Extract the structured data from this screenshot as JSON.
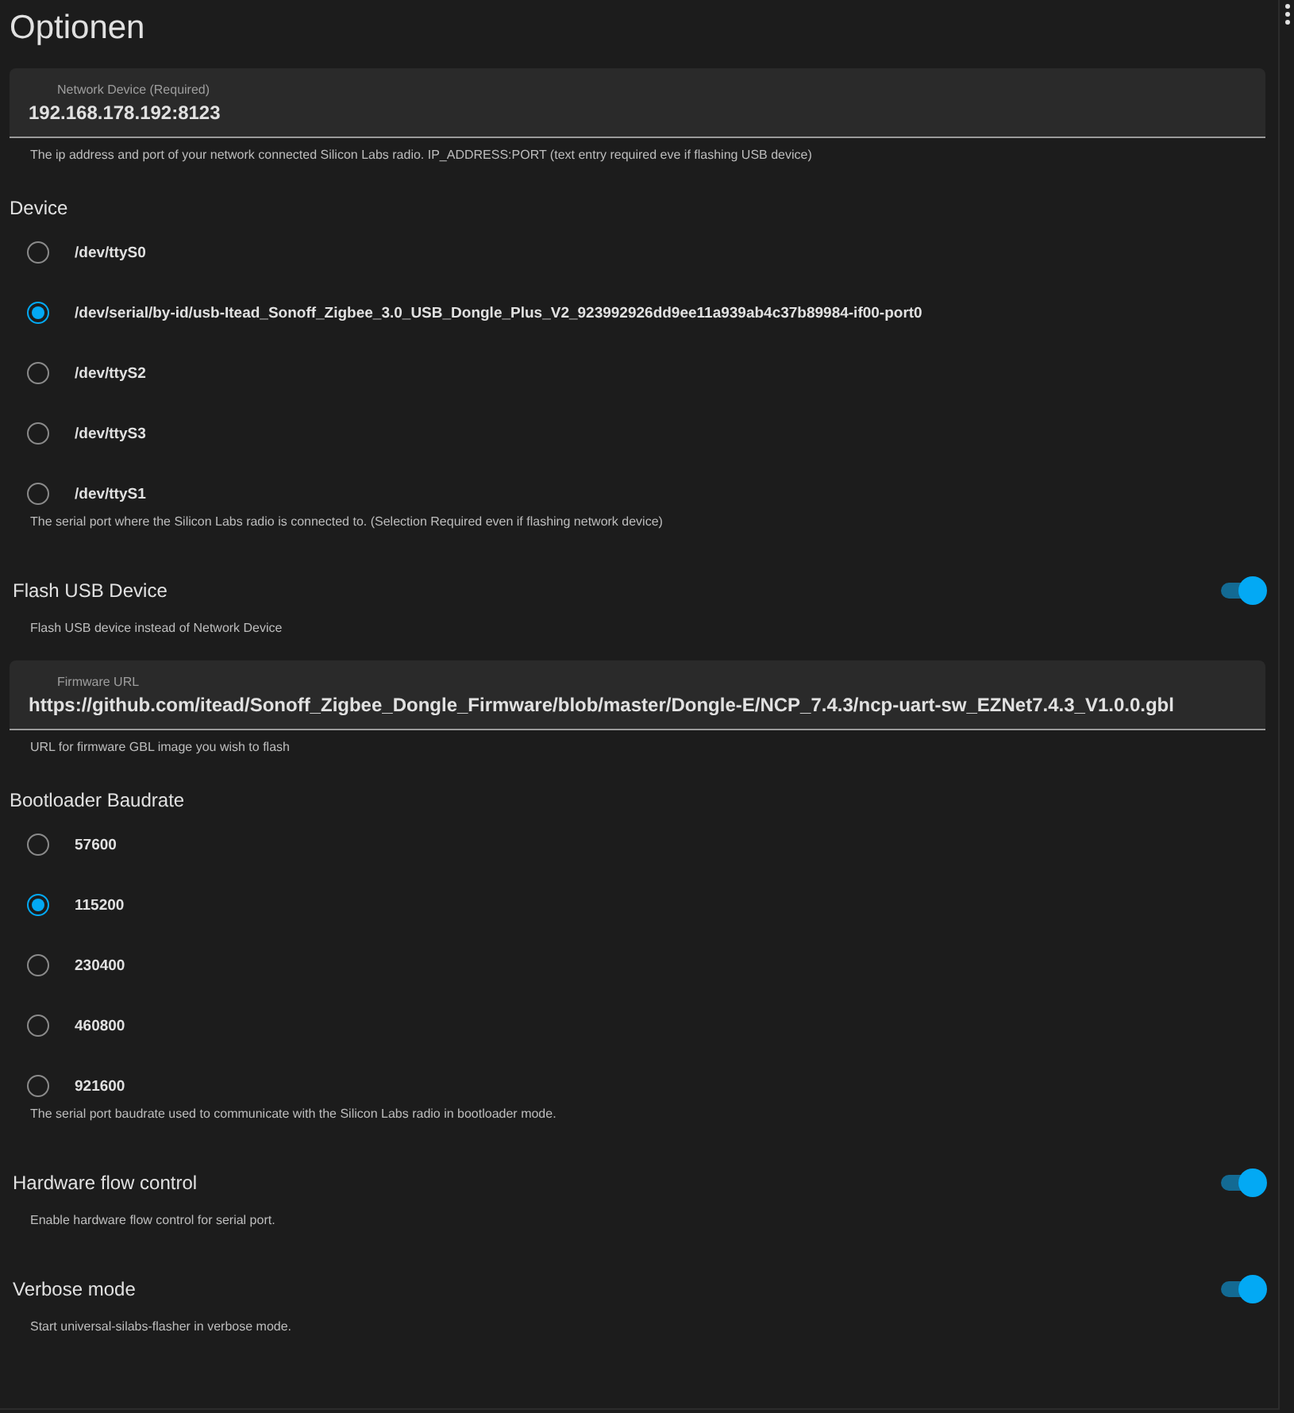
{
  "title": "Optionen",
  "sections": [
    {
      "kind": "text_field",
      "label": "Network Device (Required)",
      "value": "192.168.178.192:8123",
      "helper": "The ip address and port of your network connected Silicon Labs radio. IP_ADDRESS:PORT (text entry required eve if flashing USB device)"
    },
    {
      "kind": "radio_group",
      "label": "Device",
      "options": [
        {
          "label": "/dev/ttyS0",
          "selected": false
        },
        {
          "label": "/dev/serial/by-id/usb-Itead_Sonoff_Zigbee_3.0_USB_Dongle_Plus_V2_923992926dd9ee11a939ab4c37b89984-if00-port0",
          "selected": true
        },
        {
          "label": "/dev/ttyS2",
          "selected": false
        },
        {
          "label": "/dev/ttyS3",
          "selected": false
        },
        {
          "label": "/dev/ttyS1",
          "selected": false
        }
      ],
      "helper": "The serial port where the Silicon Labs radio is connected to. (Selection Required even if flashing network device)"
    },
    {
      "kind": "switch",
      "label": "Flash USB Device",
      "on": true,
      "helper": "Flash USB device instead of Network Device"
    },
    {
      "kind": "text_field",
      "label": "Firmware URL",
      "value": "https://github.com/itead/Sonoff_Zigbee_Dongle_Firmware/blob/master/Dongle-E/NCP_7.4.3/ncp-uart-sw_EZNet7.4.3_V1.0.0.gbl",
      "helper": "URL for firmware GBL image you wish to flash"
    },
    {
      "kind": "radio_group",
      "label": "Bootloader Baudrate",
      "options": [
        {
          "label": "57600",
          "selected": false
        },
        {
          "label": "115200",
          "selected": true
        },
        {
          "label": "230400",
          "selected": false
        },
        {
          "label": "460800",
          "selected": false
        },
        {
          "label": "921600",
          "selected": false
        }
      ],
      "helper": "The serial port baudrate used to communicate with the Silicon Labs radio in bootloader mode."
    },
    {
      "kind": "switch",
      "label": "Hardware flow control",
      "on": true,
      "helper": "Enable hardware flow control for serial port."
    },
    {
      "kind": "switch",
      "label": "Verbose mode",
      "on": true,
      "helper": "Start universal-silabs-flasher in verbose mode."
    }
  ]
}
